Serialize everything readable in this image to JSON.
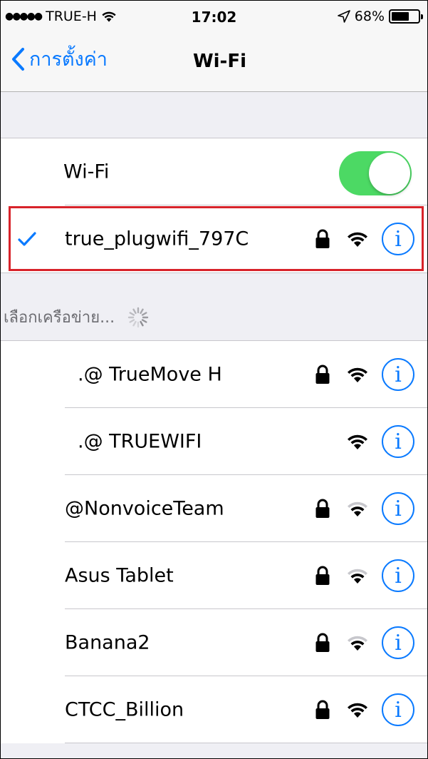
{
  "status_bar": {
    "signal_dots": "●●●●●",
    "carrier": "TRUE-H",
    "time": "17:02",
    "battery_percent": "68%",
    "battery_level": 0.68,
    "icons": [
      "wifi-icon",
      "location-arrow-icon",
      "battery-icon"
    ]
  },
  "nav": {
    "back_label": "การตั้งค่า",
    "title": "Wi-Fi"
  },
  "wifi_toggle": {
    "label": "Wi-Fi",
    "on": true,
    "color": "#4cd964"
  },
  "connected_network": {
    "name": "true_plugwifi_797C",
    "secured": true,
    "signal": "full",
    "checked": true
  },
  "section_header": "เลือกเครือข่าย...",
  "networks": [
    {
      "name": ".@ TrueMove H",
      "secured": true,
      "signal": "full"
    },
    {
      "name": ".@ TRUEWIFI",
      "secured": false,
      "signal": "full"
    },
    {
      "name": "@NonvoiceTeam",
      "secured": true,
      "signal": "weak"
    },
    {
      "name": "Asus Tablet",
      "secured": true,
      "signal": "weak"
    },
    {
      "name": "Banana2",
      "secured": true,
      "signal": "weak"
    },
    {
      "name": "CTCC_Billion",
      "secured": true,
      "signal": "full"
    }
  ],
  "info_glyph": "i",
  "colors": {
    "accent": "#0a7aff",
    "highlight": "#d8232a",
    "toggle_on": "#4cd964"
  }
}
